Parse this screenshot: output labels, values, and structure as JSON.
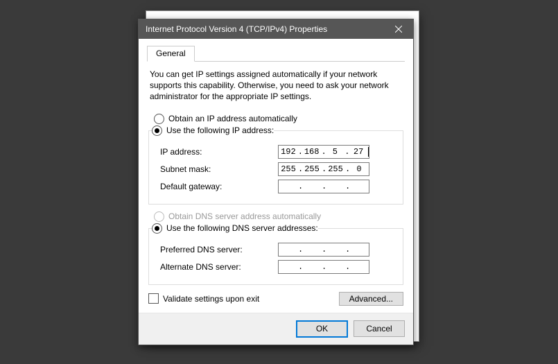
{
  "title": "Internet Protocol Version 4 (TCP/IPv4) Properties",
  "tab": "General",
  "description": "You can get IP settings assigned automatically if your network supports this capability. Otherwise, you need to ask your network administrator for the appropriate IP settings.",
  "ip_section": {
    "auto_label": "Obtain an IP address automatically",
    "manual_label": "Use the following IP address:",
    "selected": "manual",
    "fields": {
      "ip": {
        "label": "IP address:",
        "o1": "192",
        "o2": "168",
        "o3": "5",
        "o4": "27"
      },
      "mask": {
        "label": "Subnet mask:",
        "o1": "255",
        "o2": "255",
        "o3": "255",
        "o4": "0"
      },
      "gateway": {
        "label": "Default gateway:",
        "o1": "",
        "o2": "",
        "o3": "",
        "o4": ""
      }
    }
  },
  "dns_section": {
    "auto_label": "Obtain DNS server address automatically",
    "manual_label": "Use the following DNS server addresses:",
    "selected": "manual",
    "auto_enabled": false,
    "fields": {
      "preferred": {
        "label": "Preferred DNS server:",
        "o1": "",
        "o2": "",
        "o3": "",
        "o4": ""
      },
      "alternate": {
        "label": "Alternate DNS server:",
        "o1": "",
        "o2": "",
        "o3": "",
        "o4": ""
      }
    }
  },
  "validate_label": "Validate settings upon exit",
  "validate_checked": false,
  "advanced_label": "Advanced...",
  "ok_label": "OK",
  "cancel_label": "Cancel"
}
